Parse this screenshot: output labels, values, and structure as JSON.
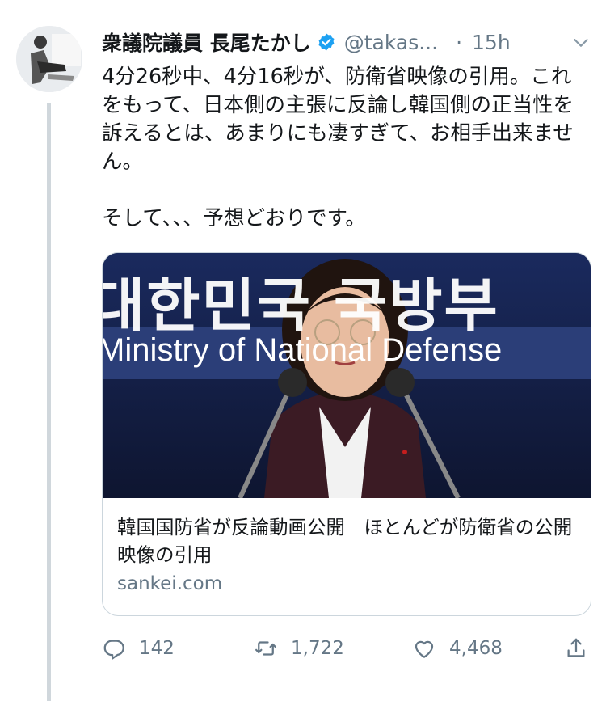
{
  "tweet": {
    "author_name": "衆議院議員 長尾たかし",
    "handle": "@takas...",
    "separator": "·",
    "time": "15h",
    "text": "4分26秒中、4分16秒が、防衛省映像の引用。これをもって、日本側の主張に反論し韓国側の正当性を訴えるとは、あまりにも凄すぎて、お相手出来ません。\n\nそして、、、予想どおりです。",
    "verified": true,
    "avatar_icon": "avatar-photo"
  },
  "card": {
    "image_text_top": "대한민국 국방부",
    "image_text_band": "Ministry of National Defense",
    "title": "韓国国防省が反論動画公開　ほとんどが防衛省の公開映像の引用",
    "domain": "sankei.com"
  },
  "actions": {
    "reply_count": "142",
    "retweet_count": "1,722",
    "like_count": "4,468"
  },
  "colors": {
    "text": "#14171a",
    "secondary": "#657786",
    "verified_blue": "#1da1f2",
    "border": "#ccd6dd",
    "thread_line": "#d0d7dc"
  }
}
